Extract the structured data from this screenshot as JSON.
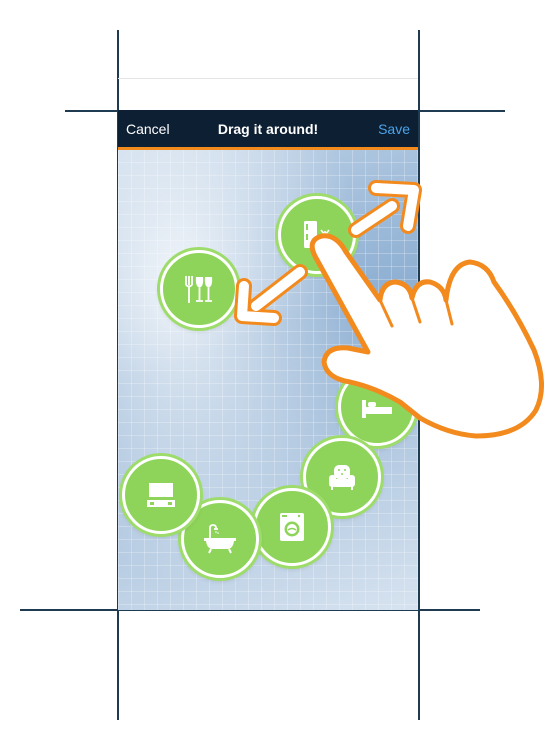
{
  "navbar": {
    "cancel_label": "Cancel",
    "title": "Drag it around!",
    "save_label": "Save"
  },
  "colors": {
    "navbar_bg": "#0d1f33",
    "accent_orange": "#f28a1e",
    "save_blue": "#4aa3ea",
    "room_green": "#8fd45a"
  },
  "rooms": [
    {
      "name": "kitchen-room",
      "icon": "kitchen-icon"
    },
    {
      "name": "dining-room",
      "icon": "dining-icon"
    },
    {
      "name": "bedroom-room",
      "icon": "bed-icon"
    },
    {
      "name": "living-room",
      "icon": "armchair-icon"
    },
    {
      "name": "laundry-room",
      "icon": "washing-machine-icon"
    },
    {
      "name": "bathroom-room",
      "icon": "bathtub-icon"
    },
    {
      "name": "tv-room",
      "icon": "tv-icon"
    }
  ],
  "gesture": {
    "hand_icon": "hand-pointer-icon",
    "arrow_icon": "drag-arrows-icon"
  }
}
